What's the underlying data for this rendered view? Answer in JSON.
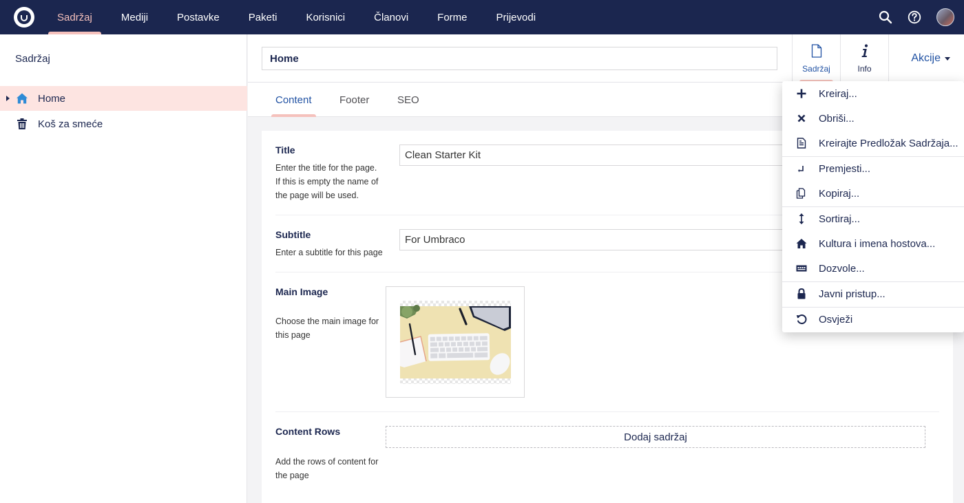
{
  "topbar": {
    "nav": [
      "Sadržaj",
      "Mediji",
      "Postavke",
      "Paketi",
      "Korisnici",
      "Članovi",
      "Forme",
      "Prijevodi"
    ],
    "active_index": 0,
    "icons": [
      "search-icon",
      "help-icon",
      "user-avatar"
    ]
  },
  "sidebar": {
    "title": "Sadržaj",
    "items": [
      {
        "label": "Home",
        "icon": "home-icon",
        "selected": true
      },
      {
        "label": "Koš za smeće",
        "icon": "trash-icon",
        "selected": false
      }
    ]
  },
  "header": {
    "name_value": "Home",
    "apps": [
      {
        "label": "Sadržaj",
        "icon": "document-icon",
        "active": true
      },
      {
        "label": "Info",
        "icon": "info-icon",
        "active": false
      }
    ],
    "actions_label": "Akcije"
  },
  "tabs": [
    "Content",
    "Footer",
    "SEO"
  ],
  "properties": {
    "title": {
      "label": "Title",
      "desc": [
        "Enter the title for the page.",
        "If this is empty the name of",
        "the page will be used."
      ],
      "value": "Clean Starter Kit"
    },
    "subtitle": {
      "label": "Subtitle",
      "desc": [
        "Enter a subtitle for this page"
      ],
      "value": "For Umbraco"
    },
    "main_image": {
      "label": "Main Image",
      "desc": [
        "Choose the main image for",
        "this page"
      ]
    },
    "content_rows": {
      "label": "Content Rows",
      "desc": [
        "Add the rows of content for",
        "the page"
      ],
      "button": "Dodaj sadržaj"
    }
  },
  "actions_menu": [
    {
      "label": "Kreiraj...",
      "icon": "plus-icon"
    },
    {
      "label": "Obriši...",
      "icon": "delete-icon"
    },
    {
      "label": "Kreirajte Predložak Sadržaja...",
      "icon": "blueprint-icon"
    },
    {
      "label": "Premjesti...",
      "icon": "move-icon"
    },
    {
      "label": "Kopiraj...",
      "icon": "copy-icon"
    },
    {
      "label": "Sortiraj...",
      "icon": "sort-icon"
    },
    {
      "label": "Kultura i imena hostova...",
      "icon": "culture-icon"
    },
    {
      "label": "Dozvole...",
      "icon": "permissions-icon"
    },
    {
      "label": "Javni pristup...",
      "icon": "lock-icon"
    },
    {
      "label": "Osvježi",
      "icon": "refresh-icon"
    }
  ],
  "colors": {
    "topbar": "#1b264f",
    "accent": "#f5c1bc",
    "link": "#2152a3",
    "selected_row": "#fde4e1"
  }
}
